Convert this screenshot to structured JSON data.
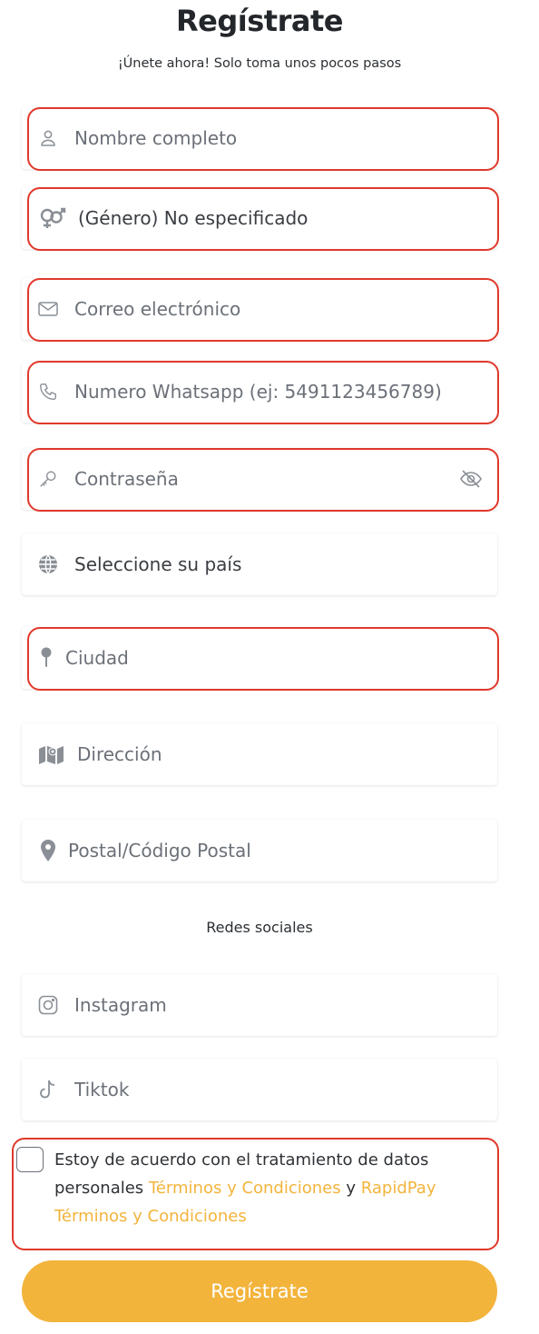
{
  "header": {
    "title": "Regístrate",
    "subtitle": "¡Únete ahora! Solo toma unos pocos pasos"
  },
  "fields": {
    "nombre": {
      "placeholder": "Nombre completo",
      "icon": "user-icon"
    },
    "genero": {
      "value": "(Género) No especificado",
      "icon": "gender-icon"
    },
    "correo": {
      "placeholder": "Correo electrónico",
      "icon": "mail-icon"
    },
    "whatsapp": {
      "placeholder": "Numero Whatsapp (ej: 5491123456789)",
      "icon": "phone-icon"
    },
    "contrasena": {
      "placeholder": "Contraseña",
      "icon": "key-icon",
      "toggle_icon": "eye-slash-icon"
    },
    "pais": {
      "value": "Seleccione su país",
      "icon": "globe-icon"
    },
    "ciudad": {
      "placeholder": "Ciudad",
      "icon": "pin-icon"
    },
    "direccion": {
      "placeholder": "Dirección",
      "icon": "map-icon"
    },
    "postal": {
      "placeholder": "Postal/Código Postal",
      "icon": "location-marker-icon"
    }
  },
  "social": {
    "label": "Redes sociales",
    "instagram": {
      "placeholder": "Instagram",
      "icon": "instagram-icon"
    },
    "tiktok": {
      "placeholder": "Tiktok",
      "icon": "tiktok-icon"
    }
  },
  "terms": {
    "text_before": "Estoy de acuerdo con el tratamiento de datos personales",
    "link1": "Términos y Condiciones",
    "connector": "y",
    "link2": "RapidPay Términos y Condiciones"
  },
  "submit": {
    "label": "Regístrate"
  },
  "colors": {
    "accent": "#f3b43c",
    "error_border": "#e0392b",
    "placeholder_text": "#6b7078"
  }
}
